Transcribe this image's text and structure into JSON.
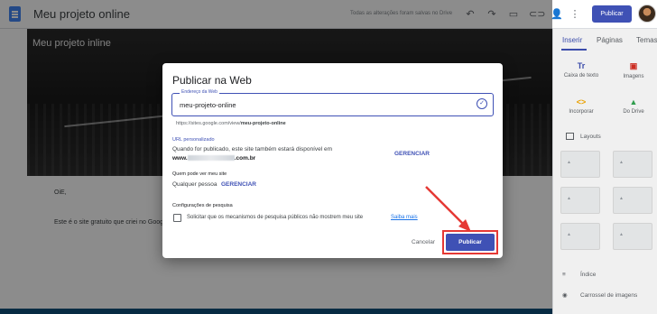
{
  "app": {
    "title": "Meu projeto online",
    "save_status": "Todas as alterações foram salvas no Drive",
    "publish_label": "Publicar"
  },
  "canvas": {
    "hero_title": "Meu projeto inline",
    "greeting": "OiE,",
    "body_text": "Este é o site gratuito que criei no Goog"
  },
  "panel": {
    "tabs": [
      "Inserir",
      "Páginas",
      "Temas"
    ],
    "insert_items": [
      {
        "label": "Caixa de texto",
        "icon": "text-box-icon"
      },
      {
        "label": "Imagens",
        "icon": "image-icon"
      },
      {
        "label": "Incorporar",
        "icon": "embed-icon"
      },
      {
        "label": "Do Drive",
        "icon": "drive-icon"
      }
    ],
    "layouts_label": "Layouts",
    "bottom_items": [
      "Índice",
      "Carrossel de imagens"
    ]
  },
  "dialog": {
    "title": "Publicar na Web",
    "address_label": "Endereço da Web",
    "address_value": "meu-projeto-online",
    "url_prefix": "https://sites.google.com/view/",
    "url_slug": "meu-projeto-online",
    "custom_url_title": "URL personalizado",
    "custom_url_text": "Quando for publicado, este site também estará disponível em",
    "domain_prefix": "www.",
    "domain_suffix": ".com.br",
    "manage_label": "GERENCIAR",
    "who_title": "Quem pode ver meu site",
    "who_value": "Qualquer pessoa",
    "search_title": "Configurações de pesquisa",
    "search_checkbox": "Solicitar que os mecanismos de pesquisa públicos não mostrem meu site",
    "learn_more": "Saiba mais",
    "cancel": "Cancelar",
    "publish": "Publicar"
  },
  "colors": {
    "accent": "#3f51b5",
    "highlight": "#e53935"
  }
}
